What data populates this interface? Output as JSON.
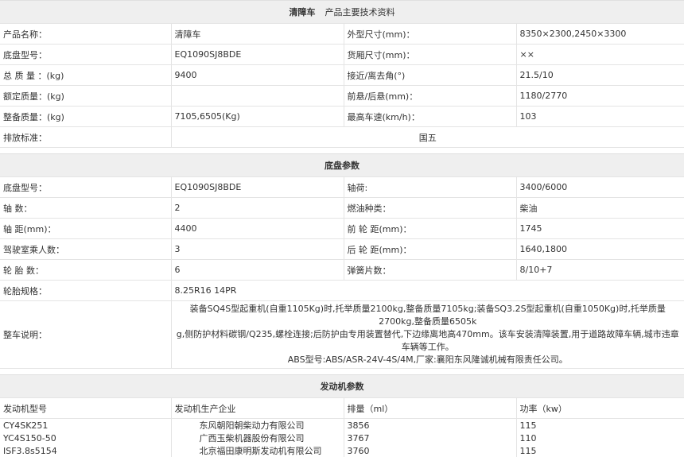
{
  "main_section": {
    "title_bold": "清障车",
    "title_sub": "产品主要技术资料",
    "rows": [
      [
        "产品名称：",
        "清障车",
        "外型尺寸(mm)：",
        "8350×2300,2450×3300"
      ],
      [
        "底盘型号：",
        "EQ1090SJ8BDE",
        "货厢尺寸(mm)：",
        "××"
      ],
      [
        "总 质 量 ：(kg)",
        "9400",
        "接近/离去角(°)",
        "21.5/10"
      ],
      [
        "额定质量：(kg)",
        "",
        "前悬/后悬(mm)：",
        "1180/2770"
      ],
      [
        "整备质量：(kg)",
        "7105,6505(Kg)",
        "最高车速(km/h)：",
        "103"
      ]
    ],
    "emission_label": "排放标准：",
    "emission_value": "国五"
  },
  "chassis_section": {
    "title": "底盘参数",
    "rows": [
      [
        "底盘型号：",
        "EQ1090SJ8BDE",
        "轴荷:",
        "3400/6000"
      ],
      [
        "轴 数：",
        "2",
        "燃油种类：",
        "柴油"
      ],
      [
        "轴 距(mm)：",
        "4400",
        "前 轮 距(mm)：",
        "1745"
      ],
      [
        "驾驶室乘人数：",
        "3",
        "后 轮 距(mm)：",
        "1640,1800"
      ],
      [
        "轮 胎 数：",
        "6",
        "弹簧片数：",
        "8/10+7"
      ]
    ],
    "tire_label": "轮胎规格：",
    "tire_value": "8.25R16 14PR",
    "note_label": "整车说明：",
    "note_line1": "装备SQ4S型起重机(自重1105Kg)时,托举质量2100kg,整备质量7105kg;装备SQ3.2S型起重机(自重1050Kg)时,托举质量2700kg,整备质量6505k",
    "note_line2": "g,侧防护材料碳钢/Q235,螺栓连接;后防护由专用装置替代,下边缘离地高470mm。该车安装清障装置,用于道路故障车辆,城市违章车辆等工作。",
    "note_line3": "ABS型号:ABS/ASR-24V-4S/4M,厂家:襄阳东风隆诚机械有限责任公司。"
  },
  "engine_section": {
    "title": "发动机参数",
    "headers": [
      "发动机型号",
      "发动机生产企业",
      "排量（ml）",
      "功率（kw）"
    ],
    "rows": [
      [
        "CY4SK251",
        "东风朝阳朝柴动力有限公司",
        "3856",
        "115"
      ],
      [
        "YC4S150-50",
        "广西玉柴机器股份有限公司",
        "3767",
        "110"
      ],
      [
        "ISF3.8s5154",
        "北京福田康明斯发动机有限公司",
        "3760",
        "115"
      ]
    ]
  }
}
